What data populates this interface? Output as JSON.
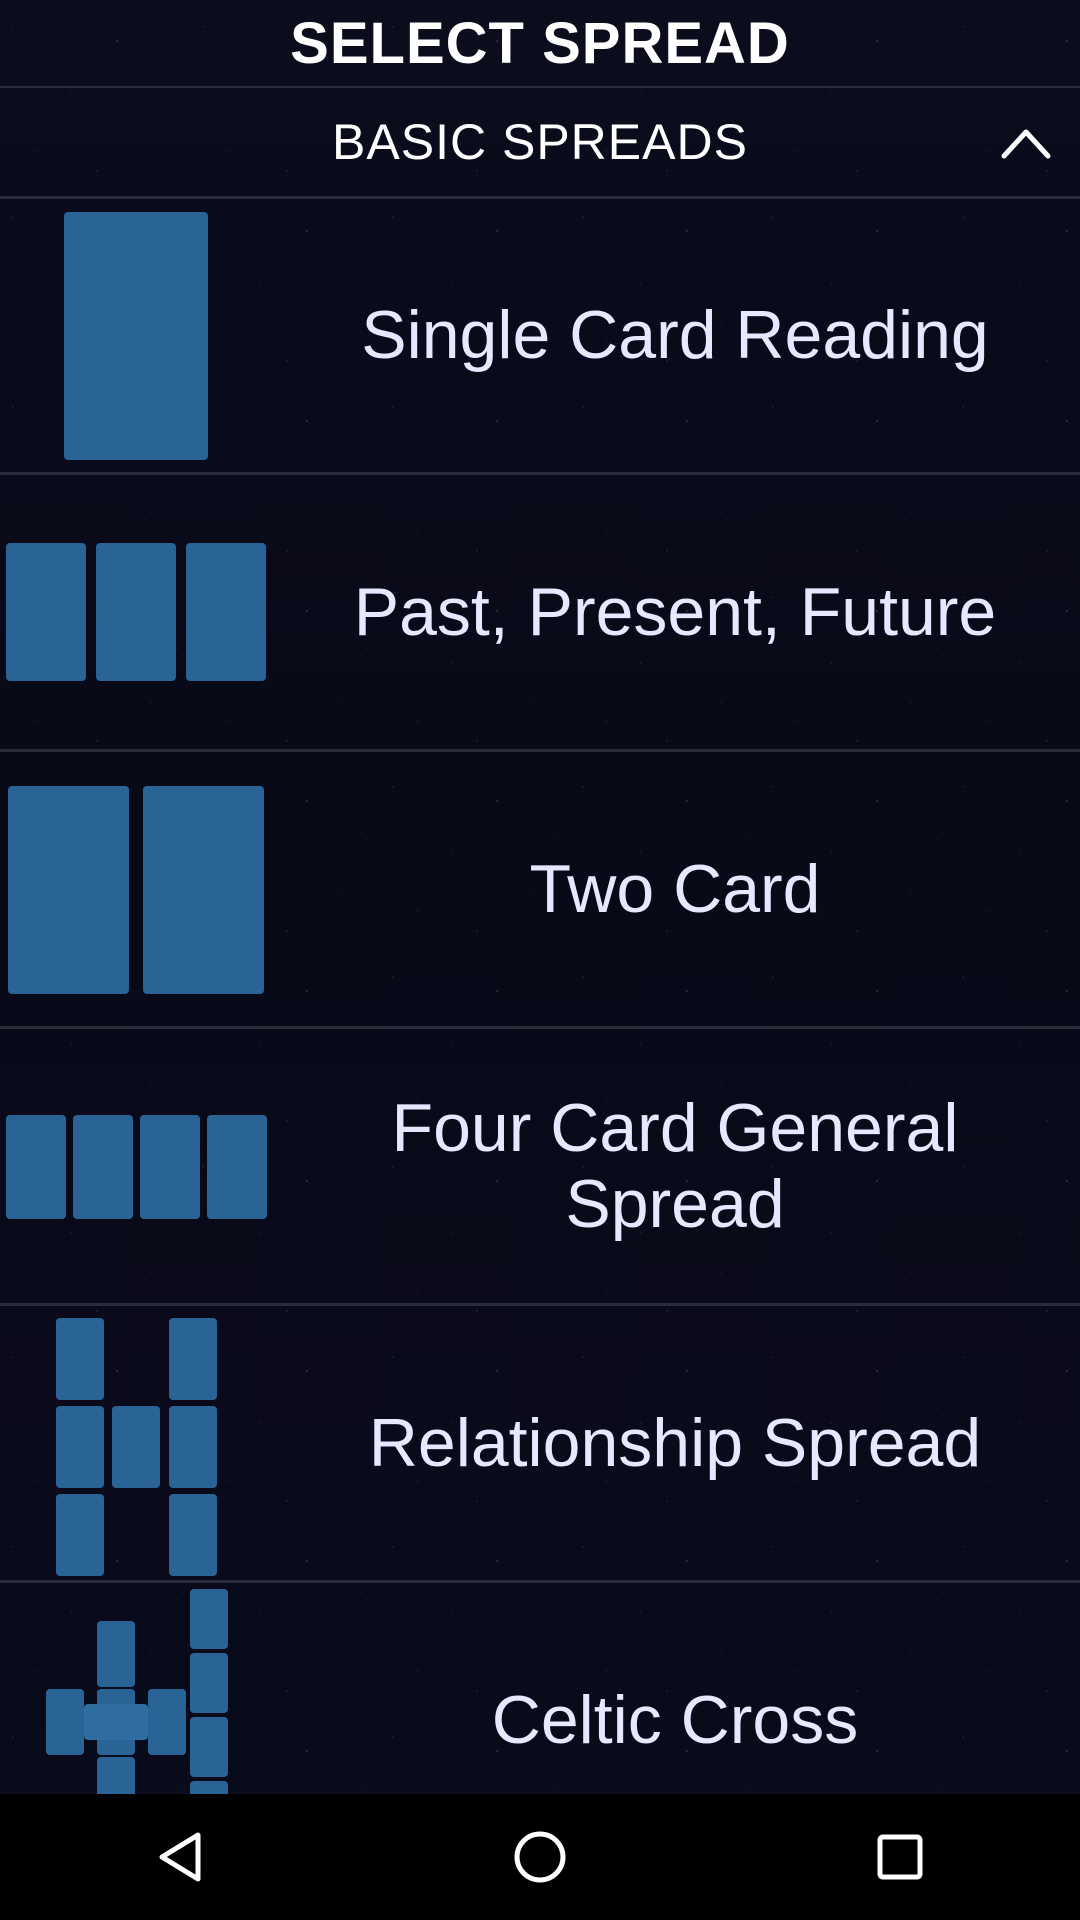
{
  "header": {
    "title": "SELECT SPREAD"
  },
  "section": {
    "label": "BASIC SPREADS",
    "collapse_icon": "chevron-up-icon"
  },
  "spreads": [
    {
      "title": "Single Card Reading",
      "icon": "single-card-icon"
    },
    {
      "title": "Past, Present, Future",
      "icon": "three-card-icon"
    },
    {
      "title": "Two Card",
      "icon": "two-card-icon"
    },
    {
      "title": "Four Card General Spread",
      "icon": "four-card-icon"
    },
    {
      "title": "Relationship Spread",
      "icon": "relationship-spread-icon"
    },
    {
      "title": "Celtic Cross",
      "icon": "celtic-cross-icon"
    }
  ],
  "navbar": {
    "back_icon": "back-triangle-icon",
    "home_icon": "home-circle-icon",
    "recents_icon": "recents-square-icon"
  },
  "colors": {
    "card": "#2a6395",
    "divider": "#2a2c3a",
    "text": "#e6e8ff"
  }
}
